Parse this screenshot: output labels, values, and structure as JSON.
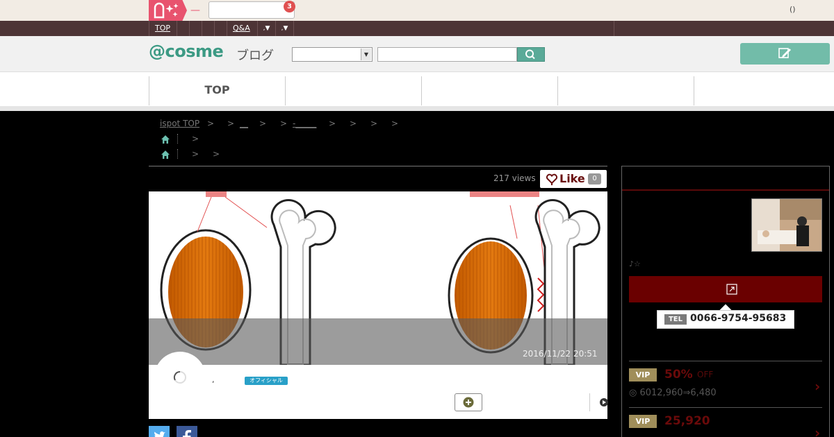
{
  "topbar": {
    "dash": "—",
    "notification_count": "3",
    "right_text": "()"
  },
  "nav": {
    "top_label": "TOP",
    "qa_label": "Q&A",
    "drop1": ",▼",
    "drop2": ",▼"
  },
  "header": {
    "brand": "@cosme",
    "brand_sub": "ブログ",
    "search_placeholder": ""
  },
  "tabs": [
    "TOP",
    "",
    "",
    "",
    ""
  ],
  "breadcrumb": {
    "line1_start": "ispot TOP",
    "sep": ">",
    "line1_link2": "__",
    "line1_link3": "-_____",
    "line2_sep": ">",
    "line3_sep1": ">",
    "line3_sep2": ">"
  },
  "post": {
    "views": "217 views",
    "like_label": "Like",
    "like_count": "0",
    "date": "2016/11/22 20:51",
    "author_comma": ",",
    "official_label": "オフィシャル"
  },
  "sidebar": {
    "salon_note": "♪☆",
    "tel_label": "TEL",
    "tel_number": "0066-9754-95683",
    "menus": [
      {
        "vip": "VIP",
        "discount": "50%",
        "off": "OFF",
        "price": "◎ 6012,960⇒6,480"
      },
      {
        "vip": "VIP",
        "discount": "25,920",
        "off": "",
        "price": ""
      }
    ]
  },
  "colors": {
    "accent": "#3c9a84",
    "nav_bg": "#4d3436",
    "reserve": "#6a0000",
    "vip_gold": "#a08e5a"
  }
}
